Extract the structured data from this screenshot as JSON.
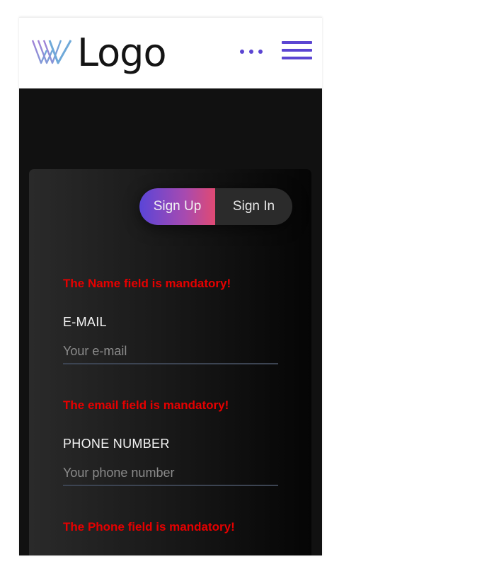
{
  "header": {
    "logo_text": "Logo",
    "logo_icon": "w-logo-mark",
    "more_icon": "more-dots-icon",
    "menu_icon": "hamburger-menu-icon",
    "accent_color": "#5b45d2"
  },
  "auth_tabs": {
    "sign_up_label": "Sign Up",
    "sign_in_label": "Sign In",
    "active": "Sign Up"
  },
  "form": {
    "name_error": "The Name field is mandatory!",
    "email": {
      "label": "E-MAIL",
      "placeholder": "Your e-mail",
      "value": "",
      "error": "The email field is mandatory!"
    },
    "phone": {
      "label": "PHONE NUMBER",
      "placeholder": "Your phone number",
      "value": "",
      "error": "The Phone field is mandatory!"
    }
  },
  "colors": {
    "error": "#e60000",
    "gradient_start": "#5a45d8",
    "gradient_end": "#e04a73"
  }
}
